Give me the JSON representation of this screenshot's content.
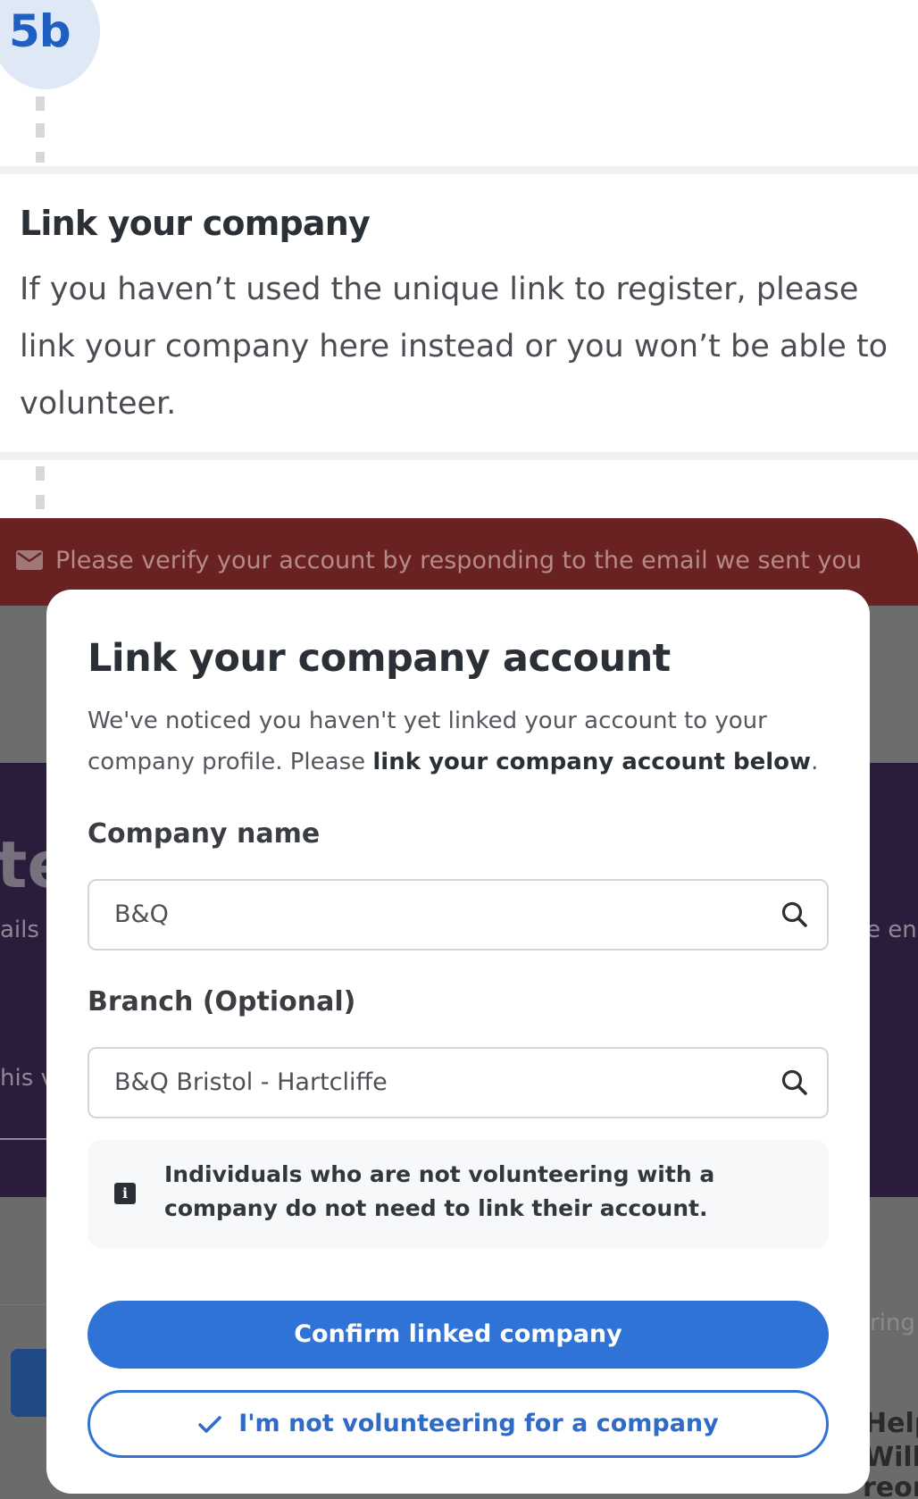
{
  "step": {
    "label": "5b"
  },
  "intro": {
    "heading": "Link your company",
    "text": "If you haven’t used the unique link to register, please link your company here instead or you won’t be able to volunteer."
  },
  "banner": {
    "icon": "envelope-icon",
    "text": "Please verify your account by responding to the email we sent you"
  },
  "background_fragments": {
    "big_text": "te",
    "left_text_1": "ails",
    "right_text_1": "e en",
    "left_text_2": "his v",
    "right_text_2": "ring",
    "right_dark_1": "Help",
    "right_dark_2": "Will",
    "right_dark_3": "reor"
  },
  "modal": {
    "title": "Link your company account",
    "description_plain": "We've noticed you haven't yet linked your account to your company profile. Please ",
    "description_bold": "link your company account below",
    "description_end": ".",
    "company_field": {
      "label": "Company name",
      "value": "B&Q",
      "icon": "search-icon"
    },
    "branch_field": {
      "label": "Branch (Optional)",
      "value": "B&Q Bristol - Hartcliffe",
      "icon": "search-icon"
    },
    "info": {
      "icon": "info-icon",
      "text": "Individuals who are not volunteering with a company do not need to link their account."
    },
    "confirm_button": "Confirm linked company",
    "not_company_button": "I'm not volunteering for a company"
  },
  "colors": {
    "primary": "#2f73d6",
    "banner": "#6a2121",
    "purple_bg": "#2c1c3b",
    "badge": "#dfe9f5"
  }
}
